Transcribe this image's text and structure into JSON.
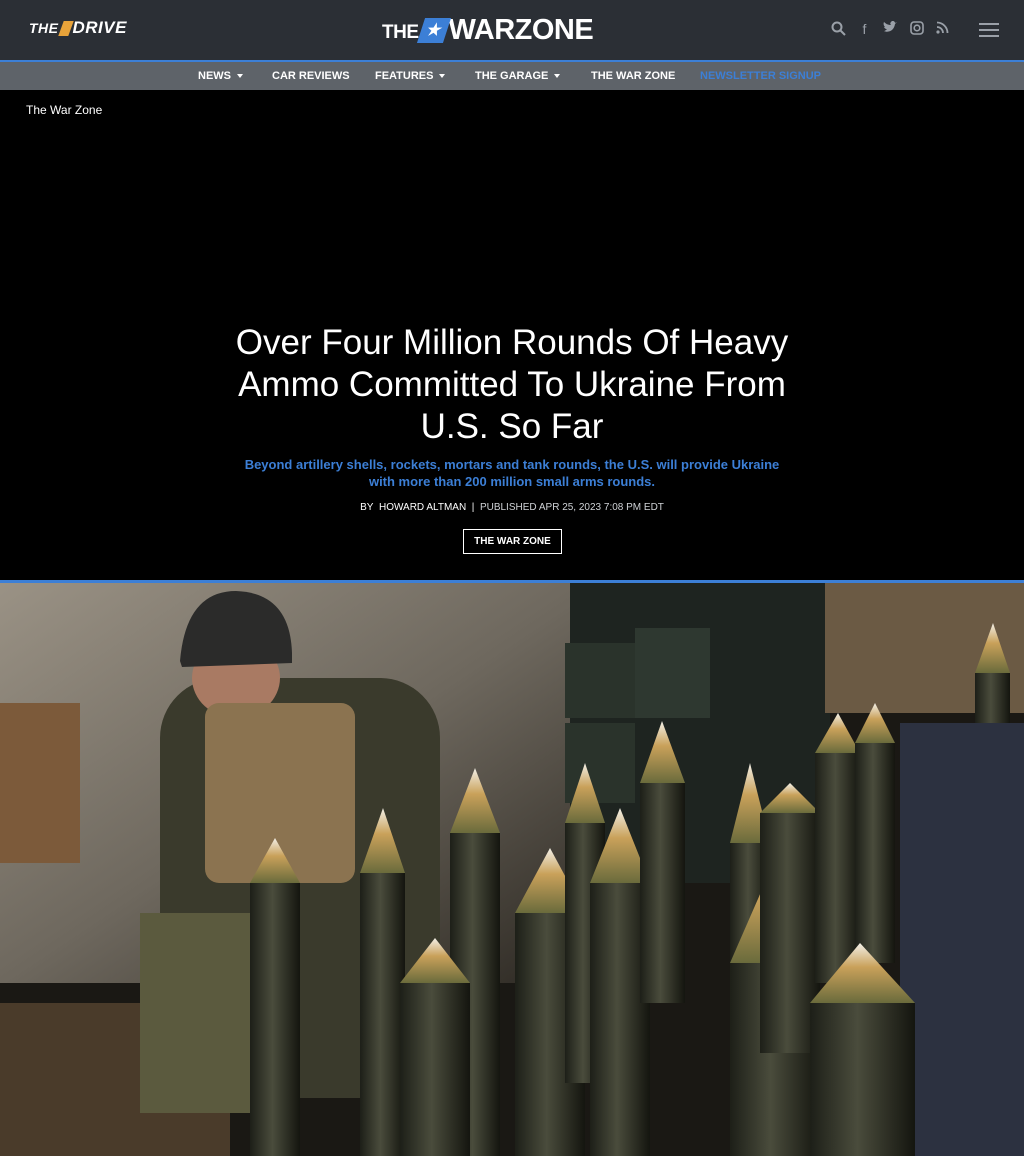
{
  "header": {
    "drive_logo": {
      "prefix": "THE",
      "name": "DRIVE"
    },
    "warzone_logo": {
      "prefix": "THE",
      "name": "WARZONE"
    },
    "icons": [
      "search-icon",
      "facebook-icon",
      "twitter-icon",
      "instagram-icon",
      "rss-icon",
      "menu-icon"
    ]
  },
  "nav": {
    "items": [
      {
        "label": "NEWS",
        "dropdown": true
      },
      {
        "label": "CAR REVIEWS",
        "dropdown": false
      },
      {
        "label": "FEATURES",
        "dropdown": true
      },
      {
        "label": "THE GARAGE",
        "dropdown": true
      },
      {
        "label": "THE WAR ZONE",
        "dropdown": false
      },
      {
        "label": "NEWSLETTER SIGNUP",
        "dropdown": false
      }
    ]
  },
  "article": {
    "breadcrumb": "The War Zone",
    "title": "Over Four Million Rounds Of Heavy Ammo Committed To Ukraine From U.S. So Far",
    "dek": "Beyond artillery shells, rockets, mortars and tank rounds, the U.S. will provide Ukraine with more than 200 million small arms rounds.",
    "by_prefix": "BY",
    "author": "HOWARD ALTMAN",
    "separator": "|",
    "published": "PUBLISHED APR 25, 2023 7:08 PM EDT",
    "tag": "THE WAR ZONE"
  },
  "colors": {
    "accent": "#3c7fd6",
    "topbar": "#2b2f35",
    "navbar": "#5e6369",
    "drive_slash": "#e8a33a"
  }
}
